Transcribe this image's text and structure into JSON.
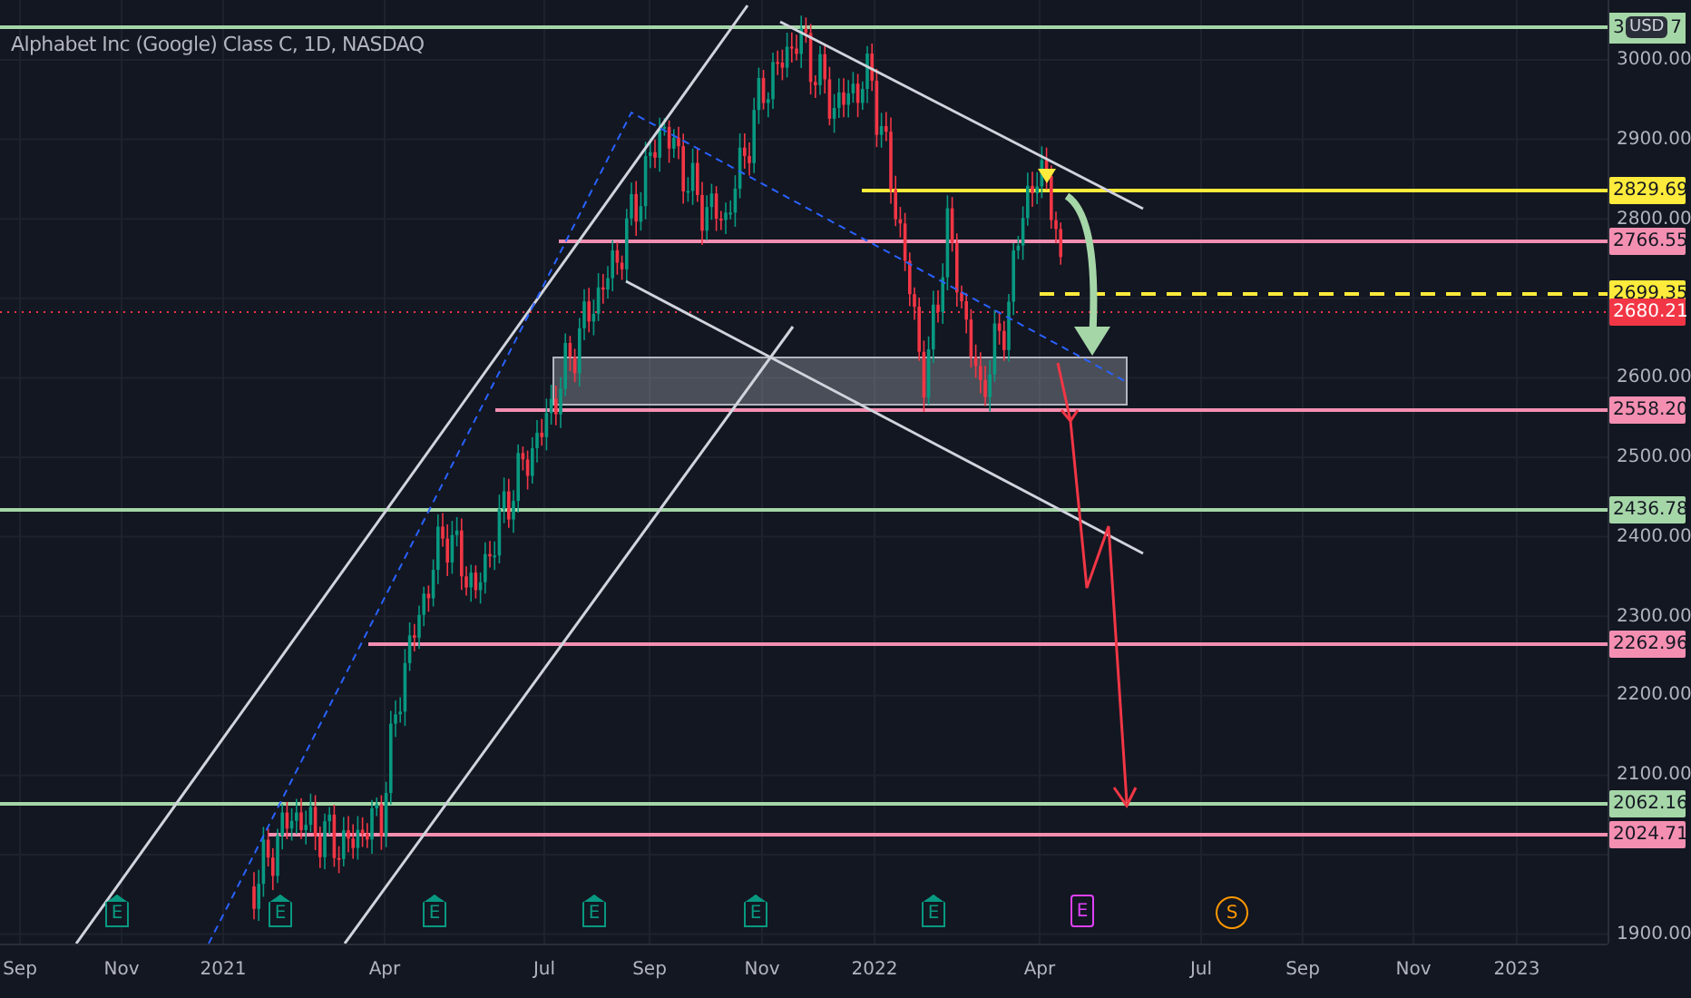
{
  "chart": {
    "title": "Alphabet Inc (Google) Class C, 1D, NASDAQ"
  },
  "currency": "USD",
  "top_line": {
    "start": "3",
    "end": "7"
  },
  "price_lines": [
    {
      "label": "2829.69",
      "kind": "yellow"
    },
    {
      "label": "2766.55",
      "kind": "pink"
    },
    {
      "label": "2699.35",
      "kind": "yellow-dashed"
    },
    {
      "label": "2680.21",
      "kind": "last-price"
    },
    {
      "label": "2558.20",
      "kind": "pink"
    },
    {
      "label": "2436.78",
      "kind": "green"
    },
    {
      "label": "2262.96",
      "kind": "pink"
    },
    {
      "label": "2062.16",
      "kind": "green"
    },
    {
      "label": "2024.71",
      "kind": "pink"
    }
  ],
  "price_axis": {
    "ticks": [
      "3000.00",
      "2900.00",
      "2800.00",
      "2600.00",
      "2500.00",
      "2400.00",
      "2300.00",
      "2200.00",
      "2100.00",
      "1900.00"
    ]
  },
  "time_axis": {
    "labels": [
      "Sep",
      "Nov",
      "2021",
      "Apr",
      "Jul",
      "Sep",
      "Nov",
      "2022",
      "Apr",
      "Jul",
      "Sep",
      "Nov",
      "2023"
    ]
  },
  "events": [
    {
      "label": "E",
      "kind": "earnings"
    },
    {
      "label": "E",
      "kind": "earnings"
    },
    {
      "label": "E",
      "kind": "earnings"
    },
    {
      "label": "E",
      "kind": "earnings"
    },
    {
      "label": "E",
      "kind": "earnings"
    },
    {
      "label": "E",
      "kind": "earnings"
    },
    {
      "label": "E",
      "kind": "upcoming-earnings"
    },
    {
      "label": "S",
      "kind": "split"
    }
  ]
}
